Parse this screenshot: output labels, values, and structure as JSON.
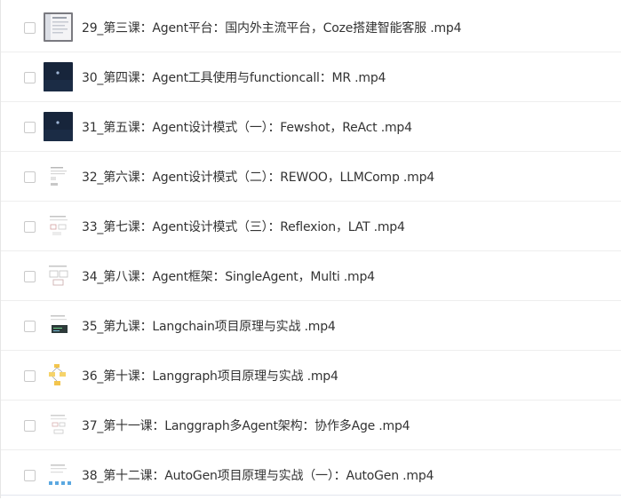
{
  "files": [
    {
      "name": "29_第三课：Agent平台：国内外主流平台，Coze搭建智能客服 .mp4",
      "thumbnail": "document-window-thumbnail"
    },
    {
      "name": "30_第四课：Agent工具使用与functioncall：MR .mp4",
      "thumbnail": "dark-video-thumbnail"
    },
    {
      "name": "31_第五课：Agent设计模式（一）：Fewshot，ReAct .mp4",
      "thumbnail": "dark-video-thumbnail"
    },
    {
      "name": "32_第六课：Agent设计模式（二）：REWOO，LLMComp .mp4",
      "thumbnail": "slide-thumbnail"
    },
    {
      "name": "33_第七课：Agent设计模式（三）：Reflexion，LAT .mp4",
      "thumbnail": "slide-thumbnail"
    },
    {
      "name": "34_第八课：Agent框架：SingleAgent，Multi .mp4",
      "thumbnail": "slide-thumbnail"
    },
    {
      "name": "35_第九课：Langchain项目原理与实战 .mp4",
      "thumbnail": "code-slide-thumbnail"
    },
    {
      "name": "36_第十课：Langgraph项目原理与实战 .mp4",
      "thumbnail": "diagram-slide-thumbnail"
    },
    {
      "name": "37_第十一课：Langgraph多Agent架构：协作多Age .mp4",
      "thumbnail": "slide-thumbnail"
    },
    {
      "name": "38_第十二课：AutoGen项目原理与实战（一）：AutoGen .mp4",
      "thumbnail": "slide-thumbnail"
    }
  ]
}
